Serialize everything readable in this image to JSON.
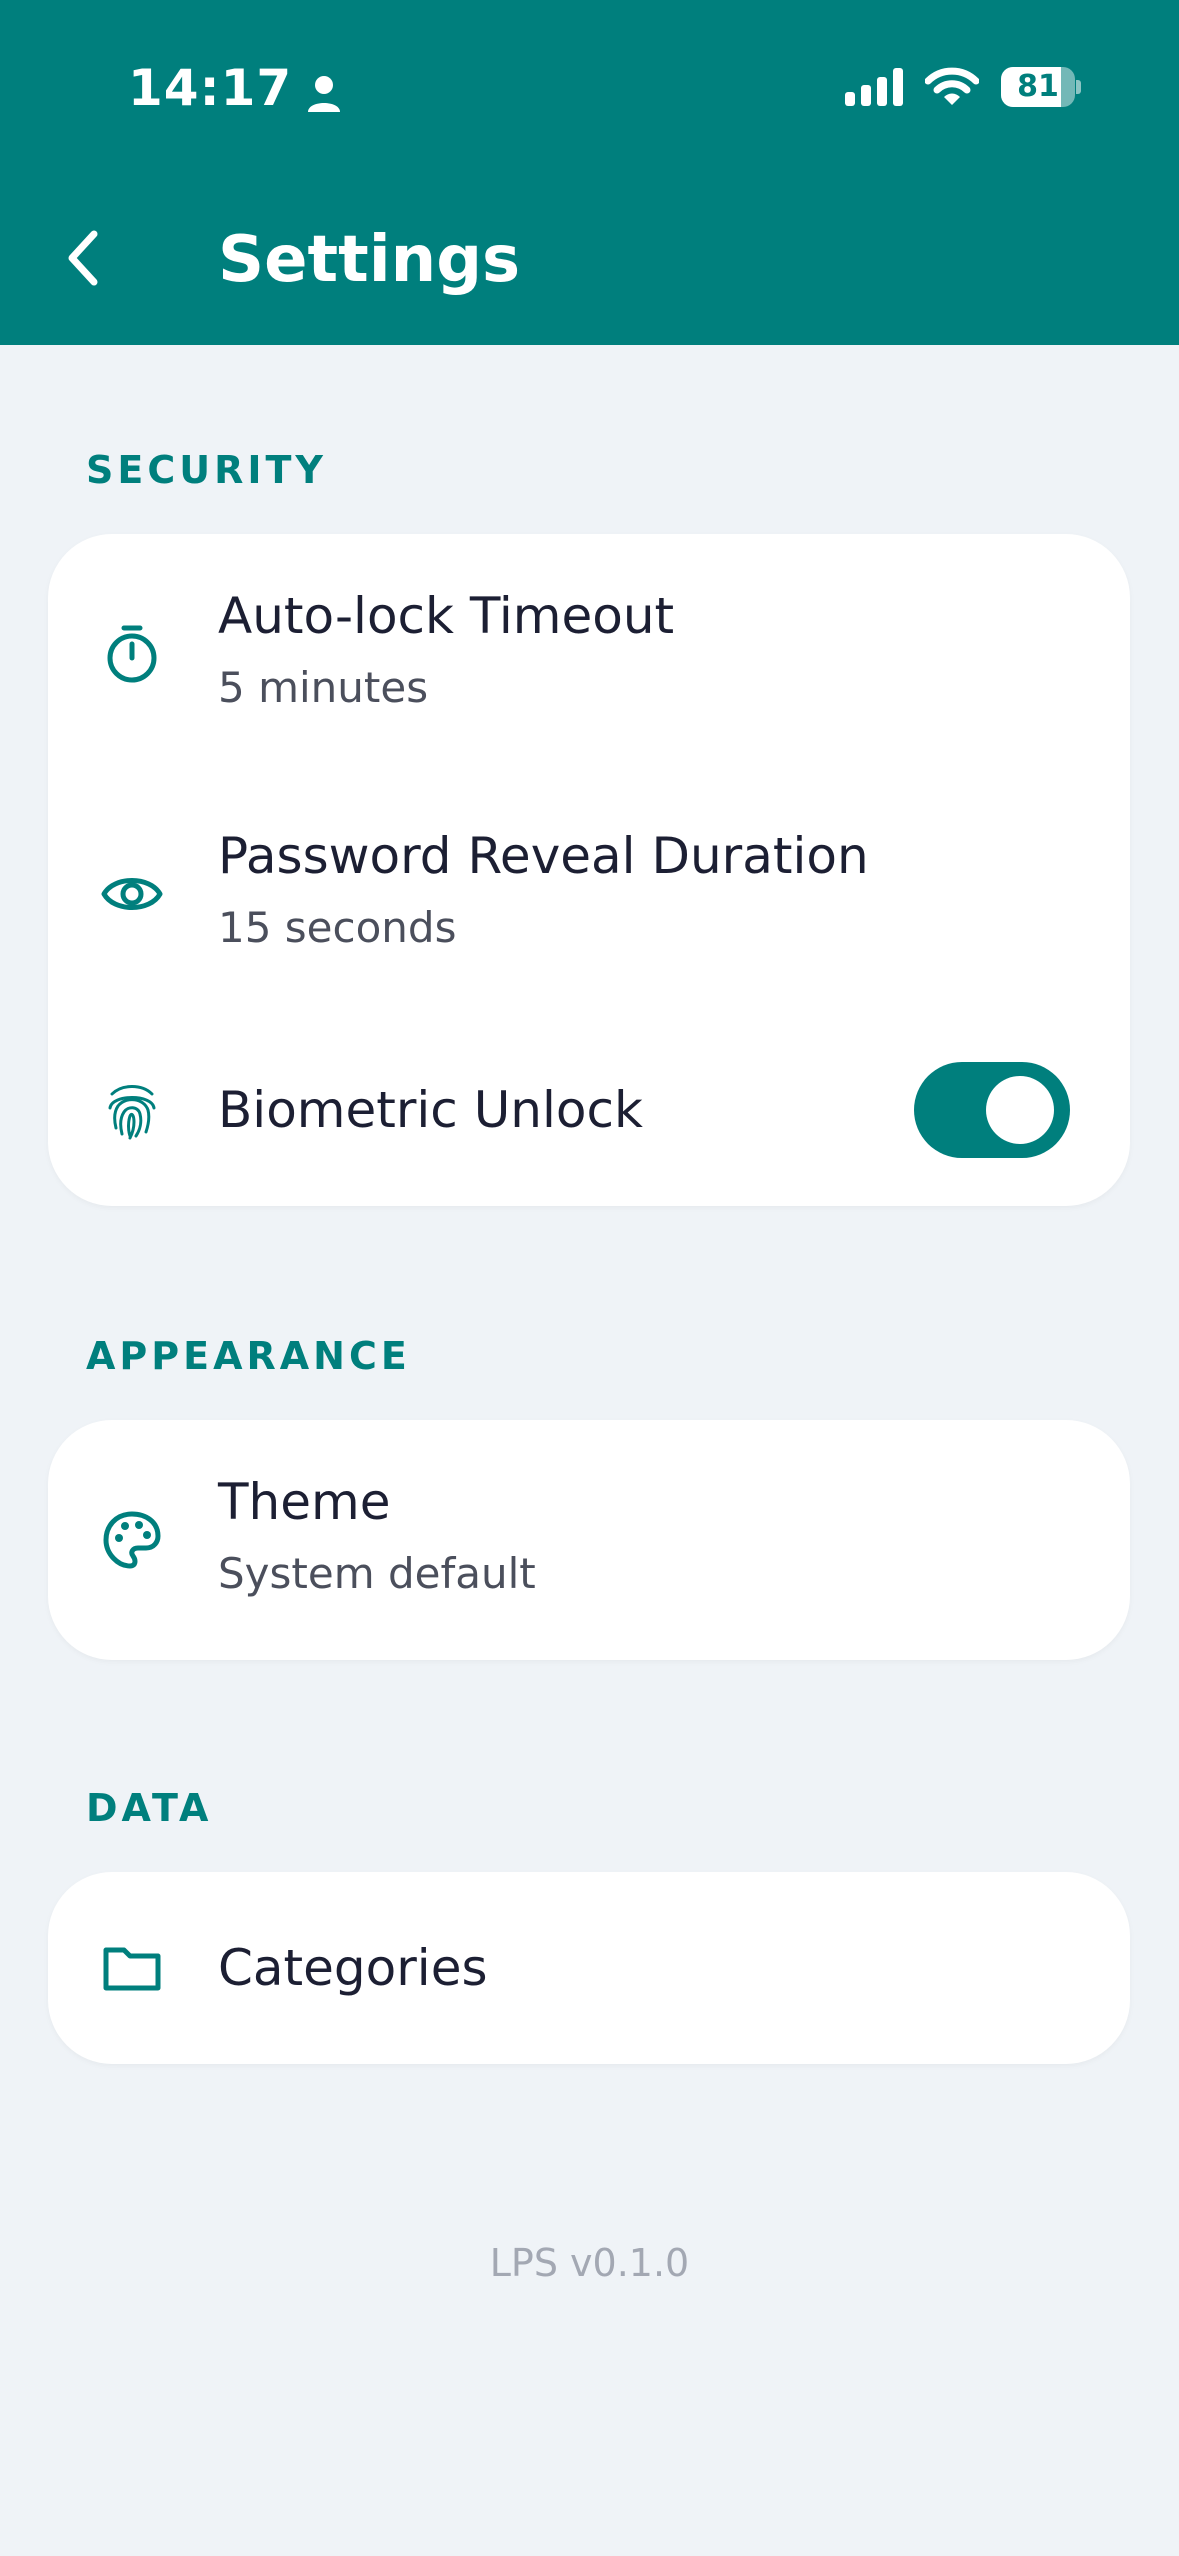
{
  "status_bar": {
    "time": "14:17",
    "battery": "81",
    "battery_level": 0.81
  },
  "header": {
    "title": "Settings"
  },
  "sections": {
    "security": {
      "label": "SECURITY",
      "items": {
        "auto_lock": {
          "title": "Auto-lock Timeout",
          "value": "5 minutes"
        },
        "reveal": {
          "title": "Password Reveal Duration",
          "value": "15 seconds"
        },
        "biometric": {
          "title": "Biometric Unlock",
          "enabled": true
        }
      }
    },
    "appearance": {
      "label": "APPEARANCE",
      "items": {
        "theme": {
          "title": "Theme",
          "value": "System default"
        }
      }
    },
    "data": {
      "label": "DATA",
      "items": {
        "categories": {
          "title": "Categories"
        }
      }
    }
  },
  "footer": {
    "version": "LPS v0.1.0"
  },
  "icons": {
    "back": "chevron-left-icon",
    "auto_lock": "timer-icon",
    "reveal": "eye-icon",
    "biometric": "fingerprint-icon",
    "theme": "palette-icon",
    "categories": "folder-icon"
  },
  "colors": {
    "primary": "#007f7d",
    "background": "#eff3f7",
    "card": "#ffffff",
    "text": "#1c1f33",
    "subtext": "#4b4f5c",
    "muted": "#a3a8b3"
  }
}
